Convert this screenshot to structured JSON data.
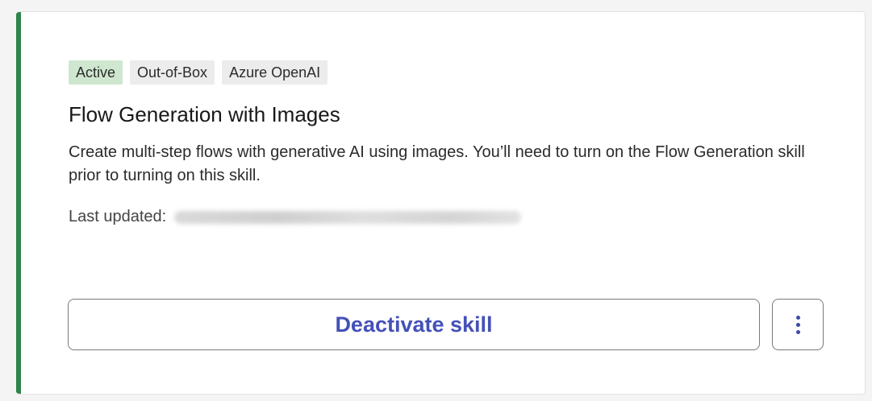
{
  "card": {
    "accent_color": "#2e844a",
    "badges": [
      {
        "label": "Active",
        "color": "#cfe7cf"
      },
      {
        "label": "Out-of-Box",
        "color": "#ececec"
      },
      {
        "label": "Azure OpenAI",
        "color": "#ececec"
      }
    ],
    "title": "Flow Generation with Images",
    "description": "Create multi-step flows with generative AI using images. You’ll need to turn on the Flow Generation skill prior to turning on this skill.",
    "last_updated_label": "Last updated:",
    "primary_action": {
      "label": "Deactivate skill",
      "color": "#4451b7"
    },
    "more_actions_icon": "vertical-ellipsis-icon"
  }
}
